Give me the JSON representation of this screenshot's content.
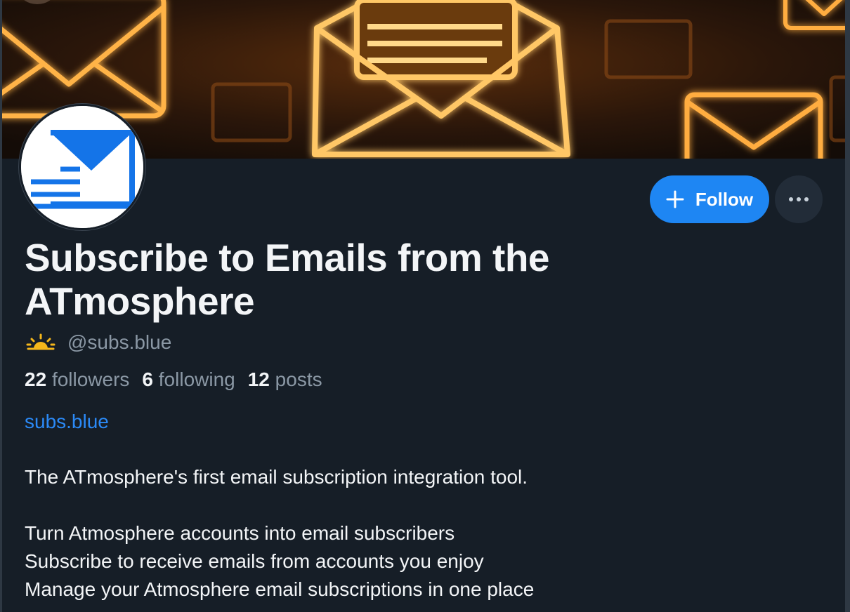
{
  "profile": {
    "display_name": "Subscribe to Emails from the ATmosphere",
    "handle": "@subs.blue",
    "status_icon": "sun-icon",
    "website": "subs.blue",
    "bio_intro": "The ATmosphere's first email subscription integration tool.",
    "bio_lines": [
      "Turn Atmosphere accounts into email subscribers",
      "Subscribe to receive emails from accounts you enjoy",
      "Manage your Atmosphere email subscriptions in one place"
    ]
  },
  "stats": {
    "followers": {
      "count": "22",
      "label": "followers"
    },
    "following": {
      "count": "6",
      "label": "following"
    },
    "posts": {
      "count": "12",
      "label": "posts"
    }
  },
  "actions": {
    "follow_label": "Follow",
    "more_icon": "ellipsis-icon"
  },
  "banner": {
    "icon": "envelope-icon"
  },
  "colors": {
    "background": "#161e27",
    "accent": "#1e86f3",
    "link": "#2b8af7",
    "muted_text": "#8b98a5",
    "sun": "#f5b71b"
  }
}
